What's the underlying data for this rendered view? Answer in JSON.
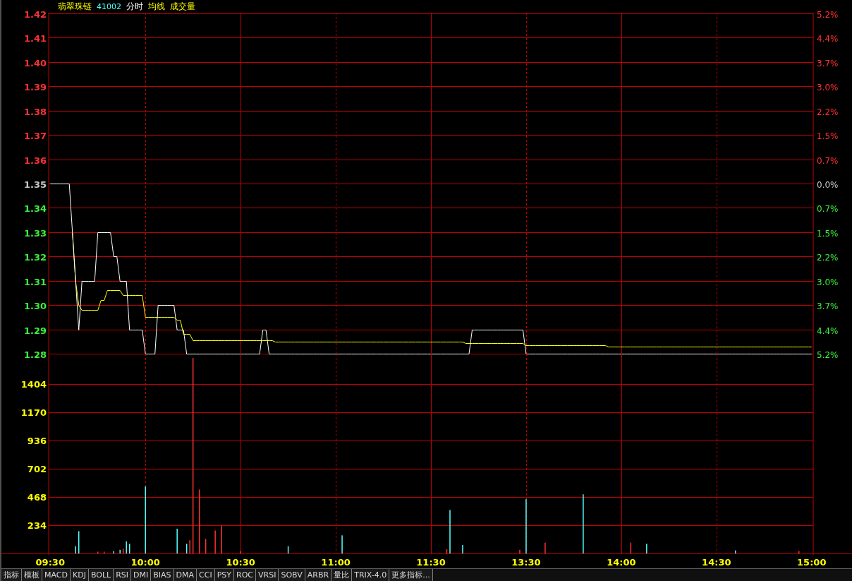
{
  "header": {
    "name": "翡翠珠链",
    "code": "41002"
  },
  "price_chart": {
    "chart_data": {
      "type": "line",
      "grid": true,
      "ylim": [
        1.28,
        1.42
      ],
      "yticks": [
        {
          "value": 1.42,
          "label": "1.42"
        },
        {
          "value": 1.41,
          "label": "1.41"
        },
        {
          "value": 1.4,
          "label": "1.40"
        },
        {
          "value": 1.39,
          "label": "1.39"
        },
        {
          "value": 1.38,
          "label": "1.38"
        },
        {
          "value": 1.37,
          "label": "1.37"
        },
        {
          "value": 1.36,
          "label": "1.36"
        },
        {
          "value": 1.35,
          "label": "1.35"
        },
        {
          "value": 1.34,
          "label": "1.34"
        },
        {
          "value": 1.33,
          "label": "1.33"
        },
        {
          "value": 1.32,
          "label": "1.32"
        },
        {
          "value": 1.31,
          "label": "1.31"
        },
        {
          "value": 1.3,
          "label": "1.30"
        },
        {
          "value": 1.29,
          "label": "1.29"
        },
        {
          "value": 1.28,
          "label": "1.28"
        }
      ],
      "categories": [
        null,
        null,
        null,
        null,
        null,
        null,
        null,
        null,
        null,
        null,
        null,
        null,
        null,
        null,
        null,
        null,
        null,
        null,
        null,
        null,
        null,
        null,
        null,
        null,
        null,
        null,
        null,
        null,
        null,
        null,
        null,
        null,
        null,
        null,
        null,
        null,
        null,
        null,
        null,
        null,
        null,
        null,
        null,
        null,
        null,
        null,
        null,
        null,
        null,
        null,
        null,
        null,
        null,
        null,
        null,
        null,
        null,
        null,
        null,
        null,
        null,
        null,
        null,
        null,
        null,
        null,
        null,
        null,
        null,
        null,
        null,
        null,
        null,
        null,
        null,
        null,
        null,
        null,
        null,
        null,
        null,
        null,
        null,
        null,
        null,
        null,
        null,
        null,
        null,
        null,
        null,
        null,
        null,
        null,
        null,
        null,
        null,
        null,
        null,
        null,
        null,
        null,
        null,
        null,
        null,
        null,
        null,
        null,
        null,
        null,
        null,
        null,
        null,
        null,
        null,
        null,
        null,
        null,
        null,
        null,
        null,
        null,
        null,
        null,
        null,
        null,
        null,
        null,
        null,
        null,
        null,
        null,
        null,
        null,
        null,
        null,
        null,
        null,
        null,
        null,
        null,
        null,
        null,
        null,
        null,
        null,
        null,
        null,
        null,
        null,
        null,
        null,
        null,
        null,
        null,
        null,
        null,
        null,
        null,
        null,
        null,
        null,
        null,
        null,
        null,
        null,
        null,
        null,
        null,
        null,
        null,
        null,
        null,
        null,
        null,
        null,
        null,
        null,
        null,
        null,
        null,
        null,
        null,
        null,
        null,
        null,
        null,
        null,
        null,
        null,
        null,
        null,
        null,
        null,
        null,
        null,
        null,
        null,
        null,
        null,
        null,
        null,
        null,
        null,
        null,
        null,
        null,
        null,
        null,
        null,
        null,
        null,
        null,
        null,
        null,
        null,
        null,
        null,
        null,
        null,
        null,
        null,
        null,
        null,
        null,
        null,
        null,
        null,
        null,
        null,
        null,
        null,
        null,
        null,
        null,
        null,
        null,
        null,
        null,
        null,
        null
      ],
      "series": [
        {
          "name": "分时",
          "color": "#ffffff",
          "values": [
            1.35,
            1.35,
            1.35,
            1.35,
            1.35,
            1.35,
            1.35,
            1.33,
            1.31,
            1.29,
            1.31,
            1.31,
            1.31,
            1.31,
            1.31,
            1.33,
            1.33,
            1.33,
            1.33,
            1.33,
            1.32,
            1.32,
            1.31,
            1.31,
            1.31,
            1.29,
            1.29,
            1.29,
            1.29,
            1.29,
            1.28,
            1.28,
            1.28,
            1.28,
            1.3,
            1.3,
            1.3,
            1.3,
            1.3,
            1.3,
            1.29,
            1.29,
            1.29,
            1.28,
            1.28,
            1.28,
            1.28,
            1.28,
            1.28,
            1.28,
            1.28,
            1.28,
            1.28,
            1.28,
            1.28,
            1.28,
            1.28,
            1.28,
            1.28,
            1.28,
            1.28,
            1.28,
            1.28,
            1.28,
            1.28,
            1.28,
            1.28,
            1.29,
            1.29,
            1.28,
            1.28,
            1.28,
            1.28,
            1.28,
            1.28,
            1.28,
            1.28,
            1.28,
            1.28,
            1.28,
            1.28,
            1.28,
            1.28,
            1.28,
            1.28,
            1.28,
            1.28,
            1.28,
            1.28,
            1.28,
            1.28,
            1.28,
            1.28,
            1.28,
            1.28,
            1.28,
            1.28,
            1.28,
            1.28,
            1.28,
            1.28,
            1.28,
            1.28,
            1.28,
            1.28,
            1.28,
            1.28,
            1.28,
            1.28,
            1.28,
            1.28,
            1.28,
            1.28,
            1.28,
            1.28,
            1.28,
            1.28,
            1.28,
            1.28,
            1.28,
            1.28,
            1.28,
            1.28,
            1.28,
            1.28,
            1.28,
            1.28,
            1.28,
            1.28,
            1.28,
            1.28,
            1.28,
            1.28,
            1.29,
            1.29,
            1.29,
            1.29,
            1.29,
            1.29,
            1.29,
            1.29,
            1.29,
            1.29,
            1.29,
            1.29,
            1.29,
            1.29,
            1.29,
            1.29,
            1.29,
            1.28,
            1.28,
            1.28,
            1.28,
            1.28,
            1.28,
            1.28,
            1.28,
            1.28,
            1.28,
            1.28,
            1.28,
            1.28,
            1.28,
            1.28,
            1.28,
            1.28,
            1.28,
            1.28,
            1.28,
            1.28,
            1.28,
            1.28,
            1.28,
            1.28,
            1.28,
            1.28,
            1.28,
            1.28,
            1.28,
            1.28,
            1.28,
            1.28,
            1.28,
            1.28,
            1.28,
            1.28,
            1.28,
            1.28,
            1.28,
            1.28,
            1.28,
            1.28,
            1.28,
            1.28,
            1.28,
            1.28,
            1.28,
            1.28,
            1.28,
            1.28,
            1.28,
            1.28,
            1.28,
            1.28,
            1.28,
            1.28,
            1.28,
            1.28,
            1.28,
            1.28,
            1.28,
            1.28,
            1.28,
            1.28,
            1.28,
            1.28,
            1.28,
            1.28,
            1.28,
            1.28,
            1.28,
            1.28,
            1.28,
            1.28,
            1.28,
            1.28,
            1.28,
            1.28,
            1.28,
            1.28,
            1.28,
            1.28,
            1.28,
            1.28,
            1.28,
            1.28,
            1.28,
            1.28,
            1.28,
            1.28
          ]
        },
        {
          "name": "均线",
          "color": "#ffff00",
          "values": [
            null,
            null,
            null,
            null,
            null,
            null,
            null,
            1.33,
            1.31,
            1.3,
            1.298,
            1.298,
            1.298,
            1.298,
            1.298,
            1.298,
            1.302,
            1.302,
            1.306,
            1.306,
            1.306,
            1.306,
            1.306,
            1.304,
            1.304,
            1.304,
            1.304,
            1.304,
            1.304,
            1.304,
            1.295,
            1.295,
            1.295,
            1.295,
            1.295,
            1.295,
            1.295,
            1.295,
            1.295,
            1.295,
            1.294,
            1.294,
            1.288,
            1.288,
            1.288,
            1.2855,
            1.2855,
            1.2855,
            1.2855,
            1.2855,
            1.2855,
            1.2855,
            1.2855,
            1.2855,
            1.2855,
            1.2855,
            1.2855,
            1.2855,
            1.2855,
            1.2855,
            1.2855,
            1.2855,
            1.2855,
            1.2855,
            1.2855,
            1.2855,
            1.2855,
            1.2855,
            1.2855,
            1.2855,
            1.2855,
            1.2848,
            1.2848,
            1.2848,
            1.2848,
            1.2848,
            1.2848,
            1.2848,
            1.2848,
            1.2848,
            1.2848,
            1.2848,
            1.2848,
            1.2848,
            1.2848,
            1.2848,
            1.2848,
            1.2848,
            1.2848,
            1.2848,
            1.2848,
            1.2848,
            1.2848,
            1.2848,
            1.2848,
            1.2848,
            1.2848,
            1.2848,
            1.2848,
            1.2848,
            1.2848,
            1.2848,
            1.2848,
            1.2848,
            1.2848,
            1.2848,
            1.2848,
            1.2848,
            1.2848,
            1.2848,
            1.2848,
            1.2848,
            1.2848,
            1.2848,
            1.2848,
            1.2848,
            1.2848,
            1.2848,
            1.2848,
            1.2848,
            1.2848,
            1.2848,
            1.2848,
            1.2848,
            1.2848,
            1.2848,
            1.2848,
            1.2848,
            1.2848,
            1.2848,
            1.2848,
            1.2843,
            1.2843,
            1.2843,
            1.2843,
            1.2843,
            1.2843,
            1.2843,
            1.2843,
            1.2843,
            1.2843,
            1.2843,
            1.2843,
            1.2843,
            1.2843,
            1.2843,
            1.2843,
            1.2843,
            1.2843,
            1.2843,
            1.2835,
            1.2835,
            1.2835,
            1.2835,
            1.2835,
            1.2835,
            1.2835,
            1.2835,
            1.2835,
            1.2835,
            1.2835,
            1.2835,
            1.2835,
            1.2835,
            1.2835,
            1.2835,
            1.2835,
            1.2835,
            1.2835,
            1.2835,
            1.2835,
            1.2835,
            1.2835,
            1.2835,
            1.2835,
            1.2835,
            1.2828,
            1.2828,
            1.2828,
            1.2828,
            1.2828,
            1.2828,
            1.2828,
            1.2828,
            1.2828,
            1.2828,
            1.2828,
            1.2828,
            1.2828,
            1.2828,
            1.2828,
            1.2828,
            1.2828,
            1.2828,
            1.2828,
            1.2828,
            1.2828,
            1.2828,
            1.2828,
            1.2828,
            1.2828,
            1.2828,
            1.2828,
            1.2828,
            1.2828,
            1.2828,
            1.2828,
            1.2828,
            1.2828,
            1.2828,
            1.2828,
            1.2828,
            1.2828,
            1.2828,
            1.2828,
            1.2828,
            1.2828,
            1.2828,
            1.2828,
            1.2828,
            1.2828,
            1.2828,
            1.2828,
            1.2828,
            1.2828,
            1.2828,
            1.2828,
            1.2828,
            1.2828,
            1.2828,
            1.2828,
            1.2828,
            1.2828,
            1.2828,
            1.2828,
            1.2828,
            1.2828,
            1.2828,
            1.2828,
            1.2828,
            1.2828
          ]
        }
      ]
    },
    "right_axis": [
      {
        "label": "5.2%",
        "kind": "up"
      },
      {
        "label": "4.4%",
        "kind": "up"
      },
      {
        "label": "3.7%",
        "kind": "up"
      },
      {
        "label": "3.0%",
        "kind": "up"
      },
      {
        "label": "2.2%",
        "kind": "up"
      },
      {
        "label": "1.5%",
        "kind": "up"
      },
      {
        "label": "0.7%",
        "kind": "up"
      },
      {
        "label": "0.0%",
        "kind": "flat"
      },
      {
        "label": "0.7%",
        "kind": "down"
      },
      {
        "label": "1.5%",
        "kind": "down"
      },
      {
        "label": "2.2%",
        "kind": "down"
      },
      {
        "label": "3.0%",
        "kind": "down"
      },
      {
        "label": "3.7%",
        "kind": "down"
      },
      {
        "label": "4.4%",
        "kind": "down"
      },
      {
        "label": "5.2%",
        "kind": "down"
      }
    ]
  },
  "volume_chart": {
    "chart_data": {
      "type": "bar",
      "title": "成交量",
      "ylim": [
        0,
        1624
      ],
      "yticks": [
        234,
        468,
        702,
        936,
        1170,
        1404
      ],
      "categories": [
        "09:30",
        null,
        null,
        null,
        null,
        null,
        null,
        null,
        null,
        null,
        null,
        null,
        null,
        null,
        null,
        null,
        null,
        null,
        null,
        null,
        null,
        null,
        null,
        null,
        null,
        null,
        null,
        null,
        null,
        null,
        "10:00",
        null,
        null,
        null,
        null,
        null,
        null,
        null,
        null,
        null,
        null,
        null,
        null,
        null,
        null,
        null,
        null,
        null,
        null,
        null,
        null,
        null,
        null,
        null,
        null,
        null,
        null,
        null,
        null,
        null,
        "10:30",
        null,
        null,
        null,
        null,
        null,
        null,
        null,
        null,
        null,
        null,
        null,
        null,
        null,
        null,
        null,
        null,
        null,
        null,
        null,
        null,
        null,
        null,
        null,
        null,
        null,
        null,
        null,
        null,
        null,
        "11:00",
        null,
        null,
        null,
        null,
        null,
        null,
        null,
        null,
        null,
        null,
        null,
        null,
        null,
        null,
        null,
        null,
        null,
        null,
        null,
        null,
        null,
        null,
        null,
        null,
        null,
        null,
        null,
        null,
        null,
        "11:30",
        null,
        null,
        null,
        null,
        null,
        null,
        null,
        null,
        null,
        null,
        null,
        null,
        null,
        null,
        null,
        null,
        null,
        null,
        null,
        null,
        null,
        null,
        null,
        null,
        null,
        null,
        null,
        null,
        null,
        "13:30",
        null,
        null,
        null,
        null,
        null,
        null,
        null,
        null,
        null,
        null,
        null,
        null,
        null,
        null,
        null,
        null,
        null,
        null,
        null,
        null,
        null,
        null,
        null,
        null,
        null,
        null,
        null,
        null,
        null,
        "14:00",
        null,
        null,
        null,
        null,
        null,
        null,
        null,
        null,
        null,
        null,
        null,
        null,
        null,
        null,
        null,
        null,
        null,
        null,
        null,
        null,
        null,
        null,
        null,
        null,
        null,
        null,
        null,
        null,
        null,
        "14:30",
        null,
        null,
        null,
        null,
        null,
        null,
        null,
        null,
        null,
        null,
        null,
        null,
        null,
        null,
        null,
        null,
        null,
        null,
        null,
        null,
        null,
        null,
        null,
        null,
        null,
        null,
        null,
        null,
        null,
        "15:00"
      ],
      "grid": true,
      "series": [
        {
          "color": "#ff3232",
          "values": [
            0,
            0,
            0,
            0,
            0,
            0,
            0,
            0,
            0,
            0,
            0,
            0,
            0,
            0,
            0,
            15,
            0,
            15,
            0,
            0,
            0,
            0,
            0,
            40,
            0,
            0,
            0,
            0,
            0,
            0,
            0,
            0,
            0,
            0,
            0,
            0,
            0,
            0,
            0,
            0,
            0,
            0,
            0,
            0,
            110,
            1620,
            0,
            530,
            0,
            120,
            0,
            0,
            190,
            0,
            230,
            0,
            0,
            0,
            0,
            0,
            20,
            0,
            0,
            0,
            0,
            0,
            0,
            0,
            0,
            0,
            0,
            0,
            0,
            0,
            0,
            0,
            0,
            0,
            0,
            0,
            0,
            0,
            0,
            0,
            0,
            0,
            0,
            0,
            0,
            0,
            0,
            0,
            0,
            0,
            0,
            0,
            0,
            0,
            0,
            0,
            0,
            0,
            0,
            0,
            0,
            0,
            0,
            0,
            0,
            0,
            0,
            0,
            0,
            0,
            0,
            0,
            0,
            0,
            0,
            0,
            0,
            0,
            0,
            0,
            0,
            35,
            0,
            0,
            0,
            0,
            0,
            0,
            0,
            0,
            0,
            0,
            0,
            0,
            0,
            0,
            0,
            0,
            0,
            0,
            0,
            0,
            0,
            0,
            30,
            0,
            0,
            0,
            0,
            0,
            0,
            0,
            90,
            0,
            0,
            0,
            0,
            0,
            0,
            0,
            0,
            0,
            0,
            0,
            0,
            0,
            0,
            0,
            0,
            0,
            0,
            0,
            0,
            0,
            0,
            0,
            0,
            0,
            0,
            90,
            0,
            0,
            0,
            0,
            0,
            0,
            0,
            0,
            0,
            0,
            0,
            0,
            0,
            0,
            0,
            0,
            0,
            0,
            0,
            0,
            0,
            0,
            0,
            0,
            0,
            0,
            0,
            0,
            0,
            0,
            0,
            0,
            0,
            0,
            0,
            0,
            0,
            0,
            0,
            0,
            0,
            0,
            0,
            0,
            0,
            0,
            0,
            0,
            0,
            0,
            0,
            0,
            20,
            0,
            0,
            0,
            0
          ]
        },
        {
          "color": "#54ffff",
          "values": [
            0,
            0,
            0,
            0,
            0,
            0,
            0,
            0,
            60,
            185,
            0,
            0,
            0,
            0,
            0,
            0,
            0,
            0,
            0,
            0,
            20,
            0,
            30,
            0,
            100,
            80,
            0,
            0,
            0,
            0,
            555,
            0,
            0,
            0,
            0,
            0,
            0,
            0,
            0,
            0,
            205,
            0,
            0,
            80,
            0,
            0,
            0,
            0,
            0,
            0,
            0,
            0,
            0,
            0,
            0,
            0,
            0,
            0,
            0,
            0,
            0,
            0,
            0,
            0,
            0,
            0,
            0,
            0,
            0,
            0,
            0,
            0,
            0,
            0,
            0,
            60,
            0,
            0,
            0,
            0,
            0,
            0,
            0,
            0,
            0,
            0,
            0,
            0,
            0,
            0,
            0,
            0,
            150,
            0,
            0,
            0,
            0,
            0,
            0,
            0,
            0,
            0,
            0,
            0,
            0,
            0,
            0,
            0,
            0,
            0,
            0,
            0,
            0,
            0,
            0,
            0,
            0,
            0,
            0,
            0,
            0,
            0,
            0,
            0,
            0,
            0,
            360,
            0,
            0,
            0,
            70,
            0,
            0,
            0,
            0,
            0,
            0,
            0,
            0,
            0,
            0,
            0,
            0,
            0,
            0,
            0,
            0,
            0,
            0,
            0,
            450,
            0,
            0,
            0,
            0,
            0,
            0,
            0,
            0,
            0,
            0,
            0,
            0,
            0,
            0,
            0,
            0,
            0,
            490,
            0,
            0,
            0,
            0,
            0,
            0,
            0,
            0,
            0,
            0,
            0,
            0,
            0,
            0,
            0,
            0,
            0,
            0,
            0,
            80,
            0,
            0,
            0,
            0,
            0,
            0,
            0,
            0,
            0,
            0,
            0,
            0,
            0,
            0,
            0,
            0,
            0,
            0,
            0,
            0,
            0,
            0,
            0,
            0,
            0,
            0,
            0,
            25,
            0,
            0,
            0,
            0,
            0,
            0,
            0,
            0,
            0,
            0,
            0,
            0,
            0,
            0,
            0,
            0,
            0,
            0,
            0,
            0,
            0,
            0,
            0,
            0
          ]
        }
      ]
    }
  },
  "tabs": [
    {
      "label": "指标",
      "selected": false
    },
    {
      "label": "模板",
      "selected": false
    },
    {
      "label": "MACD",
      "selected": false
    },
    {
      "label": "KDJ",
      "selected": false
    },
    {
      "label": "BOLL",
      "selected": false
    },
    {
      "label": "RSI",
      "selected": false
    },
    {
      "label": "DMI",
      "selected": false
    },
    {
      "label": "BIAS",
      "selected": false
    },
    {
      "label": "DMA",
      "selected": false
    },
    {
      "label": "CCI",
      "selected": false
    },
    {
      "label": "PSY",
      "selected": false
    },
    {
      "label": "ROC",
      "selected": false
    },
    {
      "label": "VRSI",
      "selected": false
    },
    {
      "label": "SOBV",
      "selected": false
    },
    {
      "label": "ARBR",
      "selected": false
    },
    {
      "label": "量比",
      "selected": false
    },
    {
      "label": "TRIX-4.0",
      "selected": false
    },
    {
      "label": "更多指标...",
      "selected": false
    }
  ]
}
